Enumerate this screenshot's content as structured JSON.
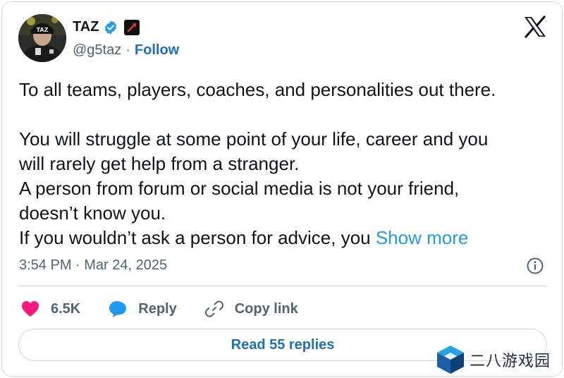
{
  "author": {
    "display_name": "TAZ",
    "handle": "@g5taz",
    "avatar_cap_text": "TAZ",
    "verified_icon": "verified-badge-icon",
    "affiliation_icon": "affiliation-badge-icon"
  },
  "follow_label": "Follow",
  "separator": "·",
  "platform_icon": "x-logo-icon",
  "tweet": {
    "line1": "To all teams, players, coaches, and personalities out there.",
    "line2": "You will struggle at some point of your life, career and you",
    "line3": "will rarely get help from a stranger.",
    "line4": "A person from forum or social media is not your friend,",
    "line5": "doesn’t know you.",
    "line6": "If you wouldn’t ask a person for advice, you",
    "show_more": "Show more"
  },
  "timestamp": "3:54 PM · Mar 24, 2025",
  "info_icon": "info-icon",
  "actions": {
    "likes": "6.5K",
    "reply": "Reply",
    "copy_link": "Copy link"
  },
  "read_replies": "Read 55 replies",
  "watermark": {
    "text": "二八游戏园",
    "icon": "cube-logo-icon"
  },
  "colors": {
    "link_blue": "#1d6ec6",
    "show_more_blue": "#1d9bf0",
    "like_pink": "#f91880",
    "reply_blue": "#1d9bf0",
    "muted_gray": "#536471",
    "border": "#cfd9de"
  }
}
